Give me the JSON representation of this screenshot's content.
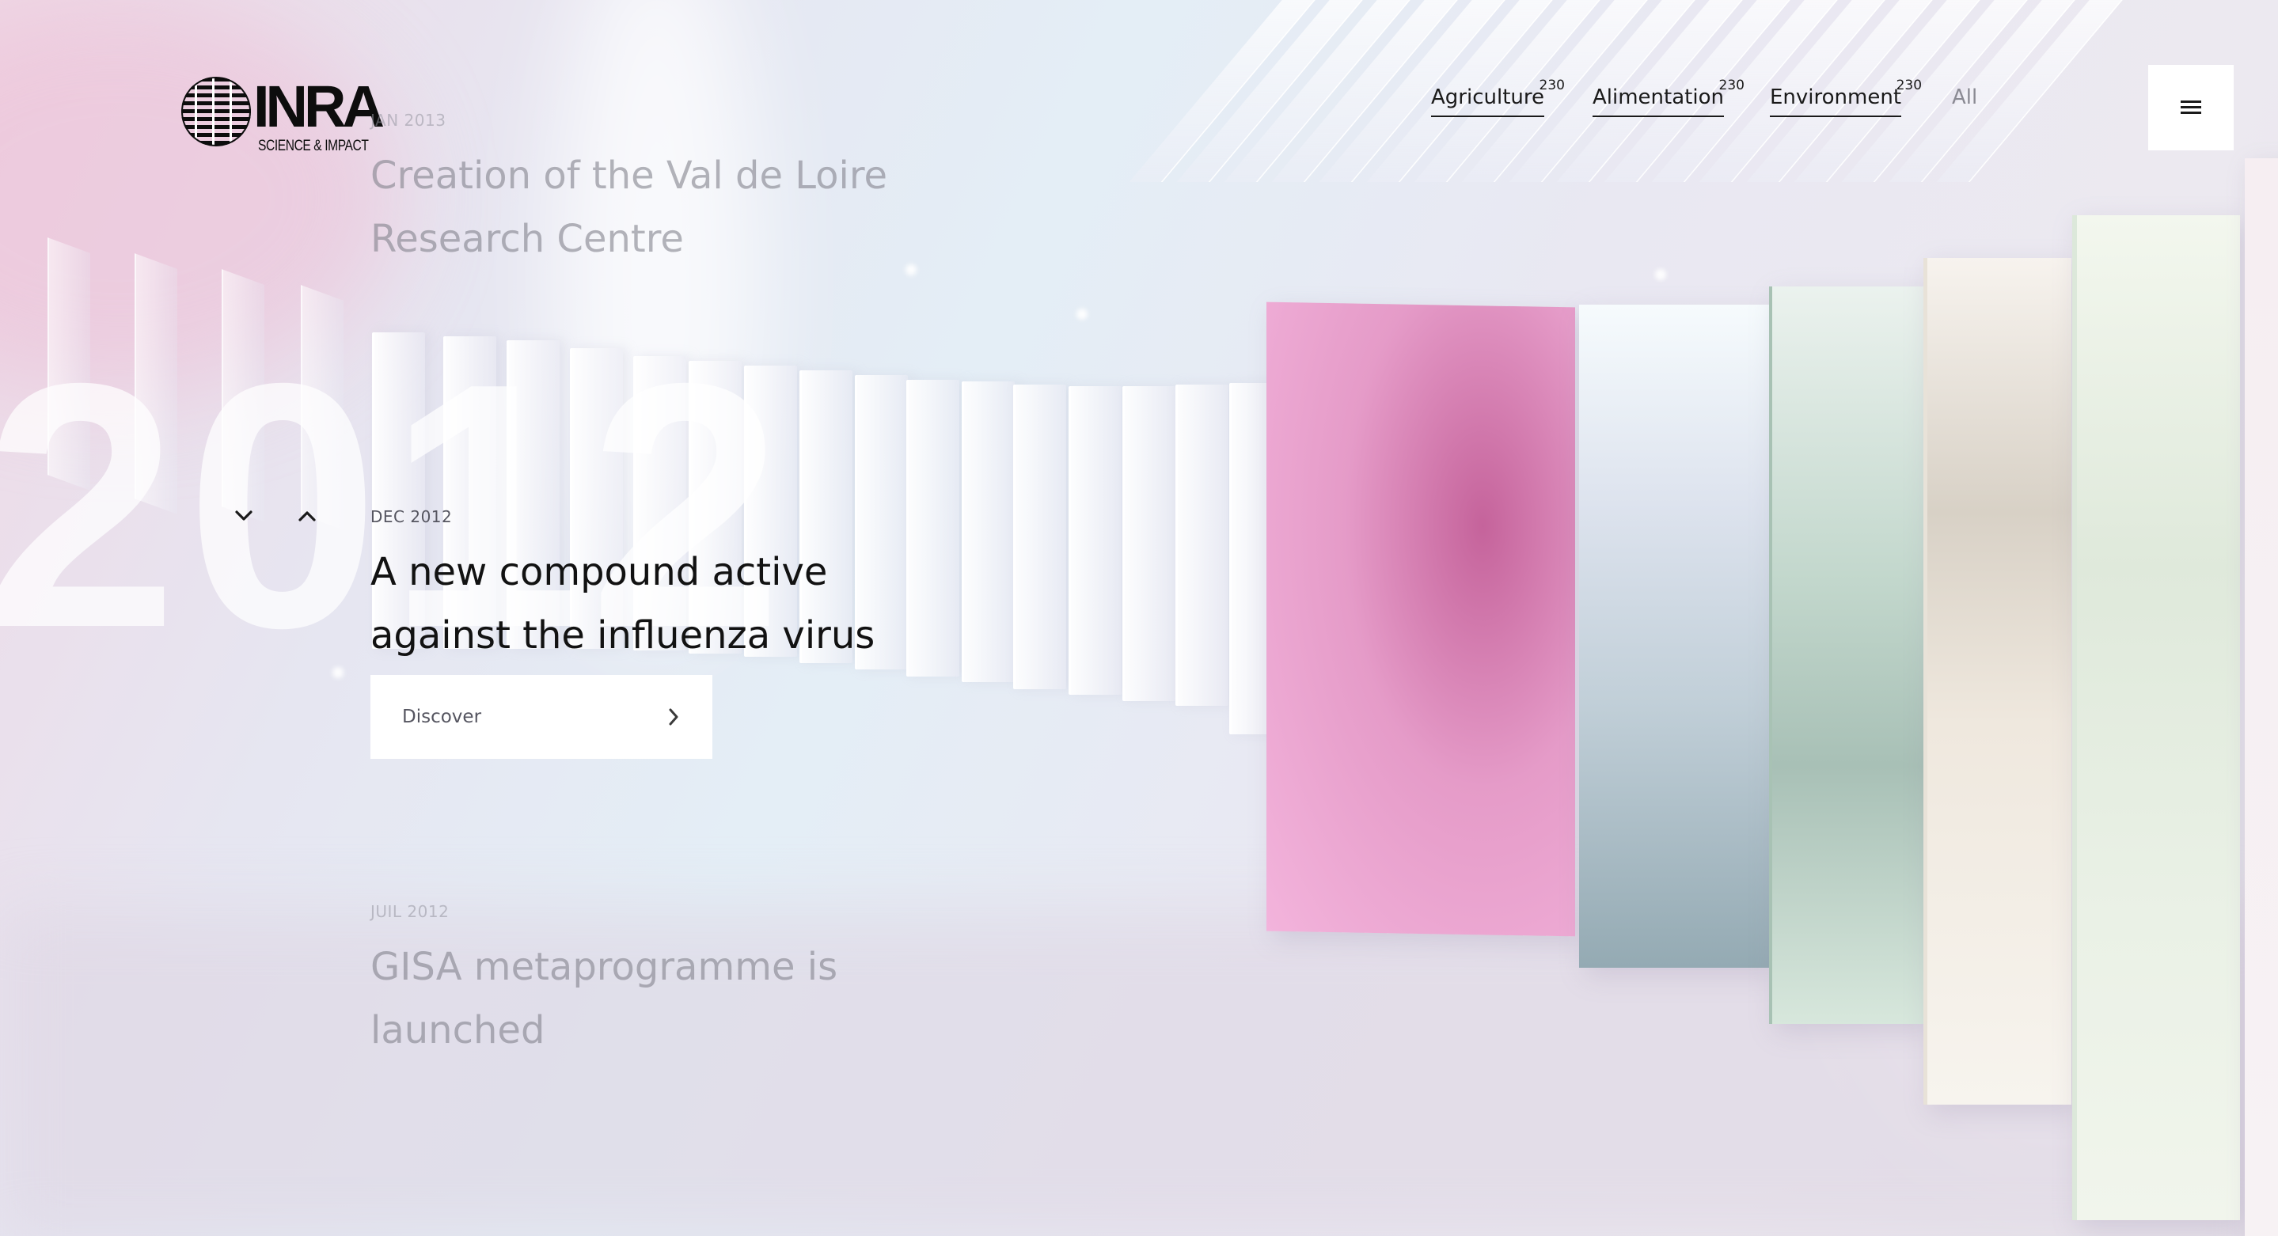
{
  "brand": {
    "name": "INRA",
    "tagline": "SCIENCE & IMPACT"
  },
  "nav": {
    "items": [
      {
        "label": "Agriculture",
        "count": "230"
      },
      {
        "label": "Alimentation",
        "count": "230"
      },
      {
        "label": "Environment",
        "count": "230"
      }
    ],
    "all_label": "All"
  },
  "menu": {
    "icon": "hamburger-icon"
  },
  "timeline": {
    "year": "2012",
    "prev_entry": {
      "date": "JAN 2013",
      "title_line1": "Creation of the Val de Loire",
      "title_line2": "Research Centre"
    },
    "current_entry": {
      "date": "DEC 2012",
      "title_line1": "A new compound active",
      "title_line2": "against the influenza virus"
    },
    "next_entry": {
      "date": "JUIL 2012",
      "title_line1": "GISA metaprogramme is",
      "title_line2": "launched"
    },
    "discover_label": "Discover",
    "icons": {
      "down": "chevron-down-icon",
      "up": "chevron-up-icon",
      "discover": "chevron-right-icon"
    }
  },
  "colors": {
    "pink_panel": "#e59bc8",
    "text_dark": "#121212",
    "text_faded": "#9a9aa4"
  }
}
